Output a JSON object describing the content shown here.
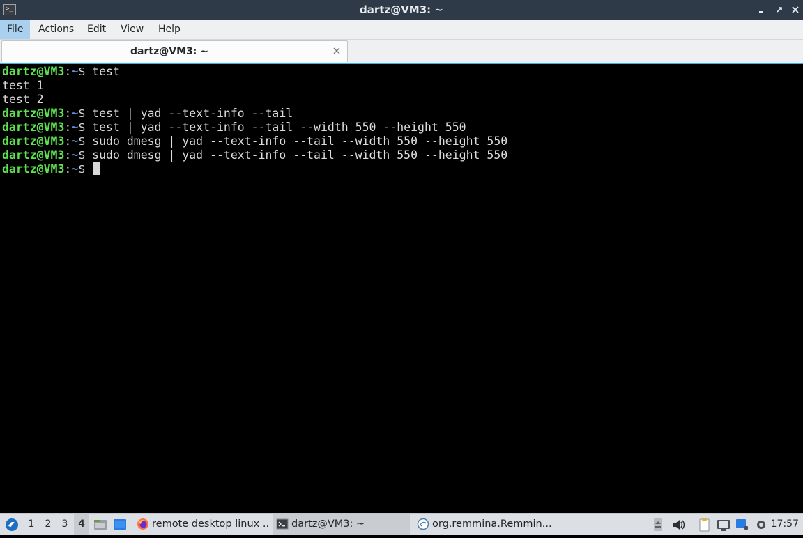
{
  "window": {
    "title": "dartz@VM3: ~",
    "app_icon": ">_"
  },
  "menubar": {
    "items": [
      {
        "label": "File",
        "active": true
      },
      {
        "label": "Actions"
      },
      {
        "label": "Edit"
      },
      {
        "label": "View"
      },
      {
        "label": "Help"
      }
    ]
  },
  "tabs": [
    {
      "label": "dartz@VM3: ~",
      "close_icon": "close-icon"
    }
  ],
  "terminal": {
    "prompt": {
      "user": "dartz@VM3",
      "sep": ":",
      "path": "~",
      "symbol": "$ "
    },
    "lines": [
      {
        "prompt": true,
        "text": "test"
      },
      {
        "prompt": false,
        "text": "test 1"
      },
      {
        "prompt": false,
        "text": "test 2"
      },
      {
        "prompt": true,
        "text": "test | yad --text-info --tail"
      },
      {
        "prompt": true,
        "text": "test | yad --text-info --tail --width 550 --height 550"
      },
      {
        "prompt": true,
        "text": "sudo dmesg | yad --text-info --tail --width 550 --height 550"
      },
      {
        "prompt": true,
        "text": "sudo dmesg | yad --text-info --tail --width 550 --height 550"
      },
      {
        "prompt": true,
        "text": ""
      }
    ]
  },
  "taskbar": {
    "workspaces": [
      "1",
      "2",
      "3",
      "4"
    ],
    "current_workspace": "4",
    "tasks": [
      {
        "label": "remote desktop linux ...",
        "icon": "firefox-icon"
      },
      {
        "label": "dartz@VM3: ~",
        "icon": "terminal-icon",
        "active": true
      },
      {
        "label": "org.remmina.Remmin...",
        "icon": "remmina-icon"
      }
    ],
    "clock": "17:57"
  },
  "colors": {
    "titlebar": "#2e3a47",
    "prompt_user": "#5de24f",
    "prompt_path": "#5a8fe0",
    "accent": "#3daee9"
  }
}
